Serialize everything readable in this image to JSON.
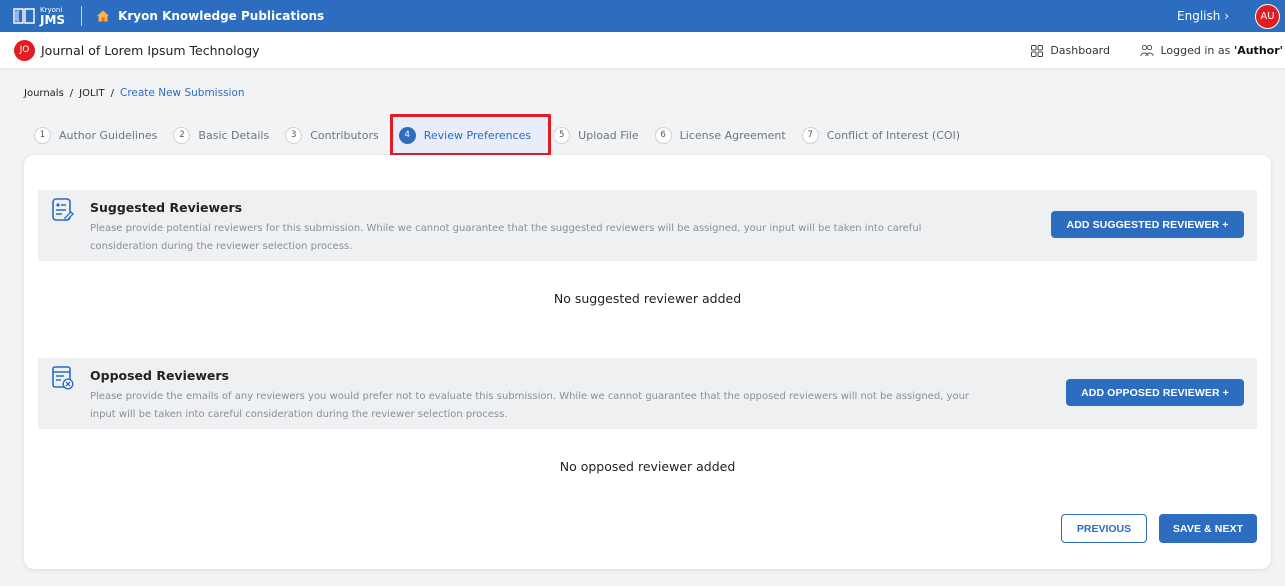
{
  "topbar": {
    "logo_small": "Kryoni",
    "logo_big": "JMS",
    "publisher": "Kryon Knowledge Publications",
    "language": "English ›",
    "user_initials": "AU"
  },
  "journalbar": {
    "journal_initials": "JO",
    "journal_title": "Journal of Lorem Ipsum Technology",
    "dashboard_label": "Dashboard",
    "logged_prefix": "Logged in as ",
    "logged_role": "'Author'"
  },
  "breadcrumb": {
    "items": [
      "Journals",
      "JOLIT",
      "Create New Submission"
    ],
    "separator": "/"
  },
  "steps": [
    {
      "num": "1",
      "label": "Author Guidelines"
    },
    {
      "num": "2",
      "label": "Basic Details"
    },
    {
      "num": "3",
      "label": "Contributors"
    },
    {
      "num": "4",
      "label": "Review Preferences"
    },
    {
      "num": "5",
      "label": "Upload File"
    },
    {
      "num": "6",
      "label": "License Agreement"
    },
    {
      "num": "7",
      "label": "Conflict of Interest (COI)"
    }
  ],
  "suggested": {
    "title": "Suggested Reviewers",
    "description": "Please provide potential reviewers for this submission. While we cannot guarantee that the suggested reviewers will be assigned, your input will be taken into careful consideration during the reviewer selection process.",
    "button": "ADD SUGGESTED REVIEWER +",
    "empty": "No suggested reviewer added"
  },
  "opposed": {
    "title": "Opposed Reviewers",
    "description": "Please provide the emails of any reviewers you would prefer not to evaluate this submission. While we cannot guarantee that the opposed reviewers will not be assigned, your input will be taken into careful consideration during the reviewer selection process.",
    "button": "ADD OPPOSED REVIEWER +",
    "empty": "No opposed reviewer added"
  },
  "footer": {
    "previous": "PREVIOUS",
    "save_next": "SAVE & NEXT"
  },
  "colors": {
    "primary": "#2c6dbf",
    "avatar_red": "#e11d21",
    "highlight_border": "#e11d21"
  },
  "icons": {
    "logo": "book-icon",
    "home": "home-icon",
    "dashboard": "grid-icon",
    "user": "users-icon",
    "suggested": "reviewer-list-icon",
    "opposed": "reviewer-remove-icon"
  }
}
